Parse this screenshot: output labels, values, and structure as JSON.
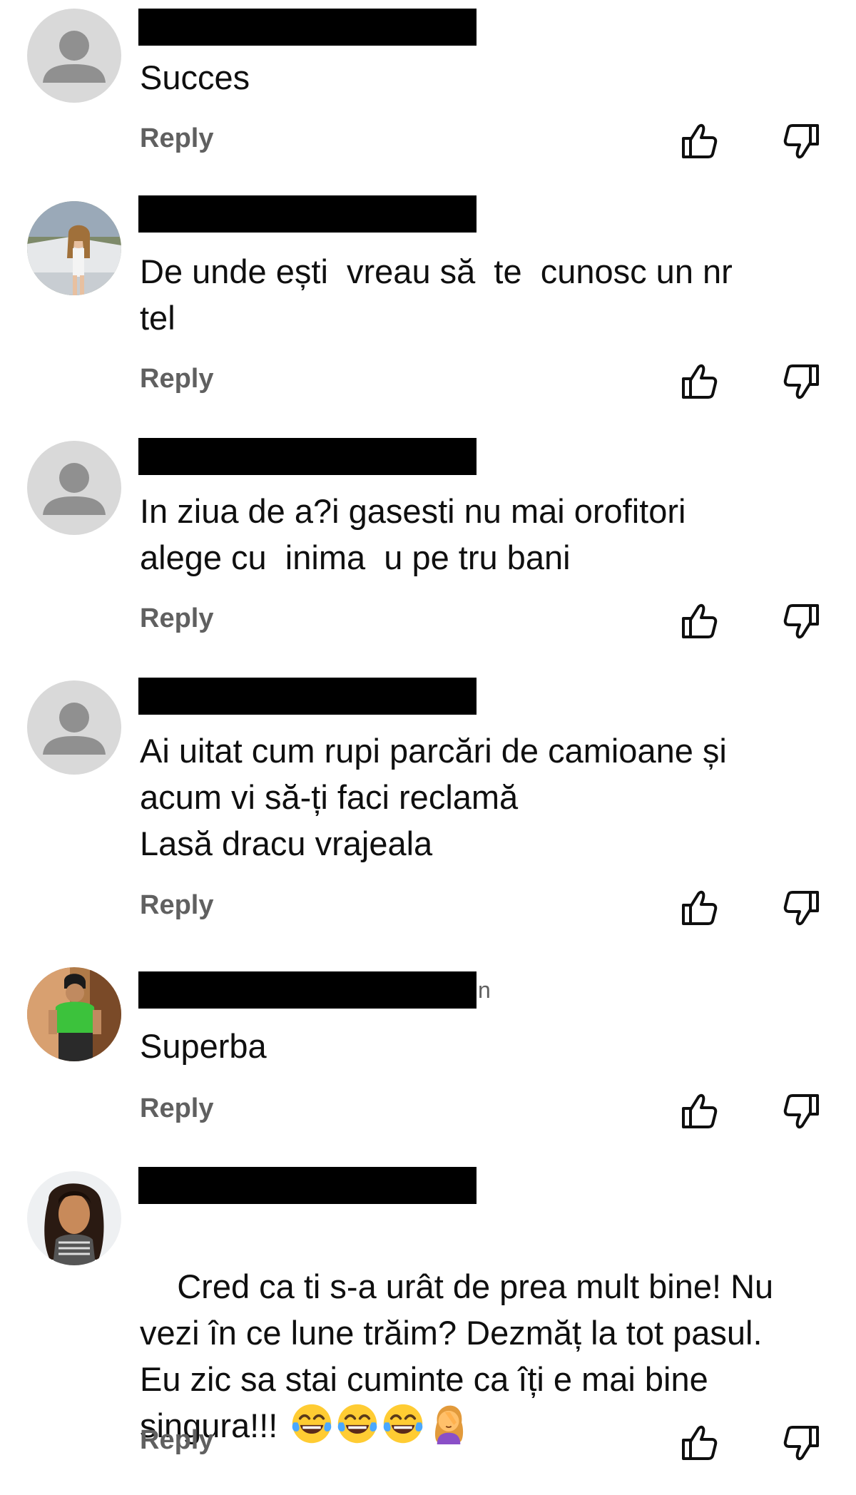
{
  "reply_label": "Reply",
  "icons": {
    "like": "thumbs-up-icon",
    "dislike": "thumbs-down-icon",
    "default_avatar": "default-avatar-icon"
  },
  "colors": {
    "text": "#0f0f0f",
    "secondary_text": "#606060",
    "redaction": "#000000",
    "default_avatar_bg": "#d9d9d9",
    "default_avatar_fg": "#909090"
  },
  "comments": [
    {
      "avatar": "default",
      "name_suffix": "",
      "text": "Succes"
    },
    {
      "avatar": "photo-girl-with-car",
      "name_suffix": "",
      "text": "De unde ești  vreau să  te  cunosc un nr\ntel"
    },
    {
      "avatar": "default",
      "name_suffix": "",
      "text": "In ziua de a?i gasesti nu mai orofitori\nalege cu  inima  u pe tru bani"
    },
    {
      "avatar": "default",
      "name_suffix": "",
      "text": "Ai uitat cum rupi parcări de camioane și\nacum vi să-ți faci reclamă\nLasă dracu vrajeala"
    },
    {
      "avatar": "photo-man-green-shirt",
      "name_suffix": "n",
      "text": "Superba"
    },
    {
      "avatar": "photo-woman-curly-hair",
      "name_suffix": "",
      "text": "Cred ca ti s-a urât de prea mult bine! Nu\nvezi în ce lune trăim? Dezmăț la tot pasul.\nEu zic sa stai cuminte ca îți e mai bine\nsingura!!! ",
      "emojis": [
        "face-with-tears-of-joy-emoji",
        "face-with-tears-of-joy-emoji",
        "face-with-tears-of-joy-emoji",
        "woman-facepalming-emoji"
      ]
    }
  ]
}
